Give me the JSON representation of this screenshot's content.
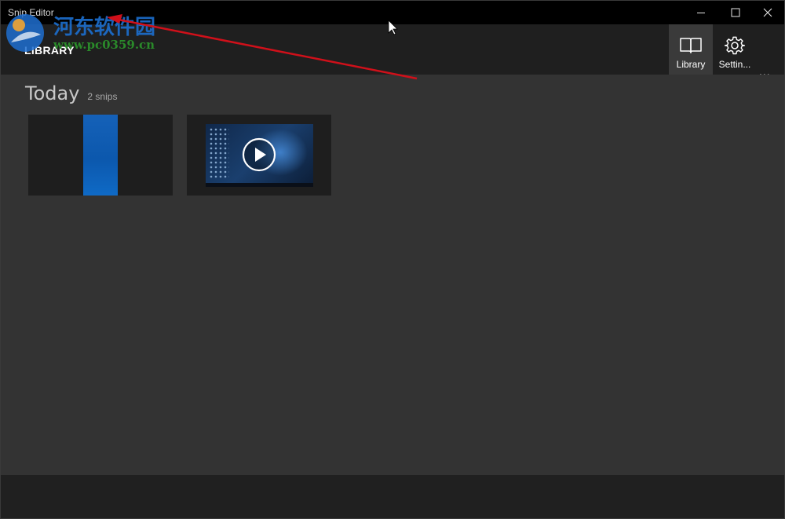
{
  "window": {
    "title": "Snip Editor",
    "controls": {
      "minimize": "minimize-icon",
      "maximize": "maximize-icon",
      "close": "close-icon"
    }
  },
  "header": {
    "title": "LIBRARY",
    "nav": [
      {
        "label": "Library",
        "icon": "book-icon",
        "selected": true
      },
      {
        "label": "Settin...",
        "icon": "gear-icon",
        "selected": false
      }
    ],
    "more": "..."
  },
  "library": {
    "group_title": "Today",
    "group_count": "2 snips",
    "snips": [
      {
        "type": "image",
        "icon": "image-thumbnail"
      },
      {
        "type": "video",
        "icon": "play-icon"
      }
    ]
  },
  "watermark": {
    "brand": "河东软件园",
    "url": "www.pc0359.cn"
  },
  "colors": {
    "titlebar": "#000000",
    "header": "#1f1f1f",
    "content": "#333333",
    "selected_nav": "#3a3a3a",
    "annotation_arrow": "#d0101a",
    "watermark_blue": "#1c6fd0",
    "watermark_green": "#2a8a2a"
  }
}
